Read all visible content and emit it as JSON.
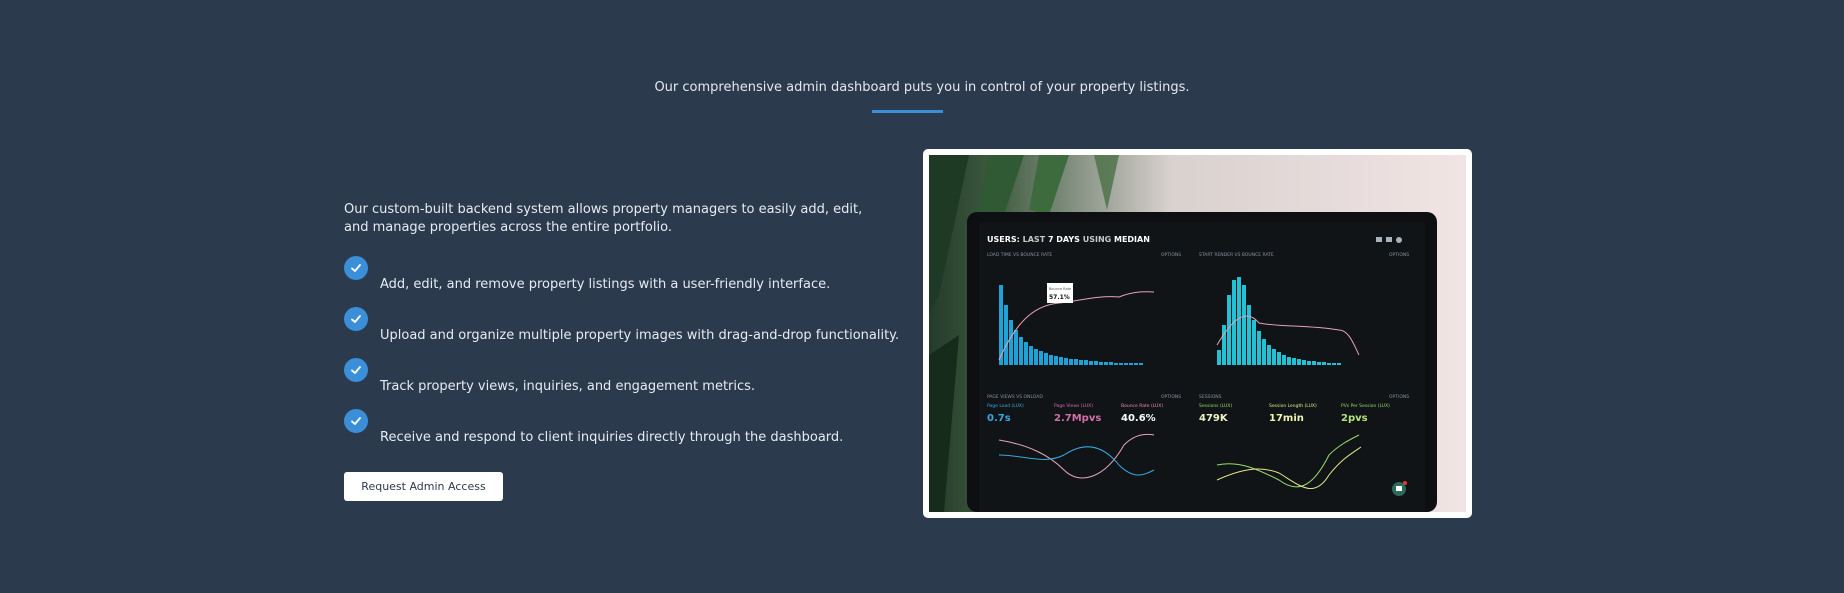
{
  "header": {
    "subtitle": "Our comprehensive admin dashboard puts you in control of your property listings."
  },
  "intro": "Our custom-built backend system allows property managers to easily add, edit, and manage properties across the entire portfolio.",
  "features": [
    "Add, edit, and remove property listings with a user-friendly interface.",
    "Upload and organize multiple property images with drag-and-drop functionality.",
    "Track property views, inquiries, and engagement metrics.",
    "Receive and respond to client inquiries directly through the dashboard."
  ],
  "cta_label": "Request Admin Access",
  "colors": {
    "background": "#2c3a4d",
    "accent": "#3a8fd8"
  },
  "screenshot": {
    "heading_parts": [
      "USERS:",
      "LAST",
      "7 DAYS",
      "USING",
      "MEDIAN"
    ],
    "panel_titles": [
      "LOAD TIME VS BOUNCE RATE",
      "START RENDER VS BOUNCE RATE",
      "PAGE VIEWS VS ONLOAD",
      "SESSIONS"
    ],
    "options_label": "OPTIONS",
    "tooltip_label": "Bounce Rate",
    "tooltip_value": "57.1%",
    "metrics": [
      {
        "label": "Page Load (LUX)",
        "value": "0.7s"
      },
      {
        "label": "Page Views (LUX)",
        "value": "2.7Mpvs"
      },
      {
        "label": "Bounce Rate (LUX)",
        "value": "40.6%"
      },
      {
        "label": "Sessions (LUX)",
        "value": "479K"
      },
      {
        "label": "Session Length (LUX)",
        "value": "17min"
      },
      {
        "label": "PVs Per Session (LUX)",
        "value": "2pvs"
      }
    ]
  }
}
